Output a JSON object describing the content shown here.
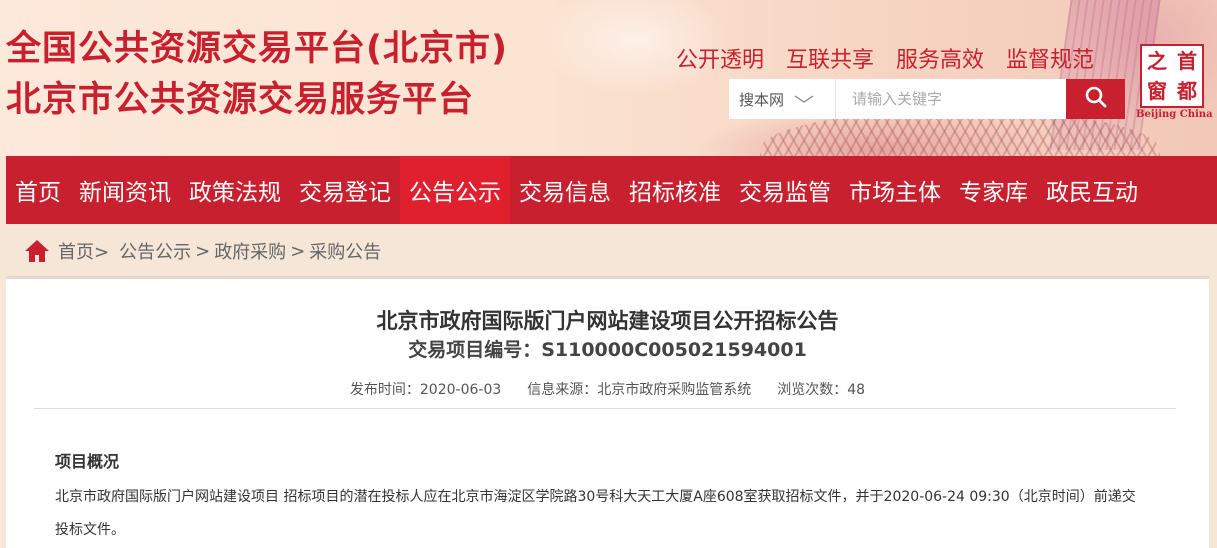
{
  "header": {
    "title_line1": "全国公共资源交易平台(北京市)",
    "title_line2": "北京市公共资源交易服务平台",
    "slogans": [
      "公开透明",
      "互联共享",
      "服务高效",
      "监督规范"
    ],
    "search": {
      "scope": "搜本网",
      "placeholder": "请输入关键字",
      "button_icon": "search-icon"
    },
    "logo": {
      "chars": [
        "首",
        "都",
        "之",
        "窗"
      ],
      "caption": "Beijing China"
    }
  },
  "nav": {
    "items": [
      "首页",
      "新闻资讯",
      "政策法规",
      "交易登记",
      "公告公示",
      "交易信息",
      "招标核准",
      "交易监管",
      "市场主体",
      "专家库",
      "政民互动"
    ],
    "active_index": 4
  },
  "breadcrumb": {
    "home_icon": "home-icon",
    "items": [
      "首页>",
      "公告公示",
      ">",
      "政府采购",
      ">",
      "采购公告"
    ]
  },
  "article": {
    "title": "北京市政府国际版门户网站建设项目公开招标公告",
    "code_label": "交易项目编号：S110000C005021594001",
    "publish_label": "发布时间：",
    "publish_value": "2020-06-03",
    "source_label": "信息来源：",
    "source_value": "北京市政府采购监管系统",
    "views_label": "浏览次数：",
    "views_value": "48",
    "section_title": "项目概况",
    "paragraph": "北京市政府国际版门户网站建设项目 招标项目的潜在投标人应在北京市海淀区学院路30号科大天工大厦A座608室获取招标文件，并于2020-06-24 09:30（北京时间）前递交投标文件。"
  },
  "colors": {
    "brand_red": "#c8202f",
    "nav_active": "#e0202f",
    "page_bg": "#f6e6d8"
  }
}
